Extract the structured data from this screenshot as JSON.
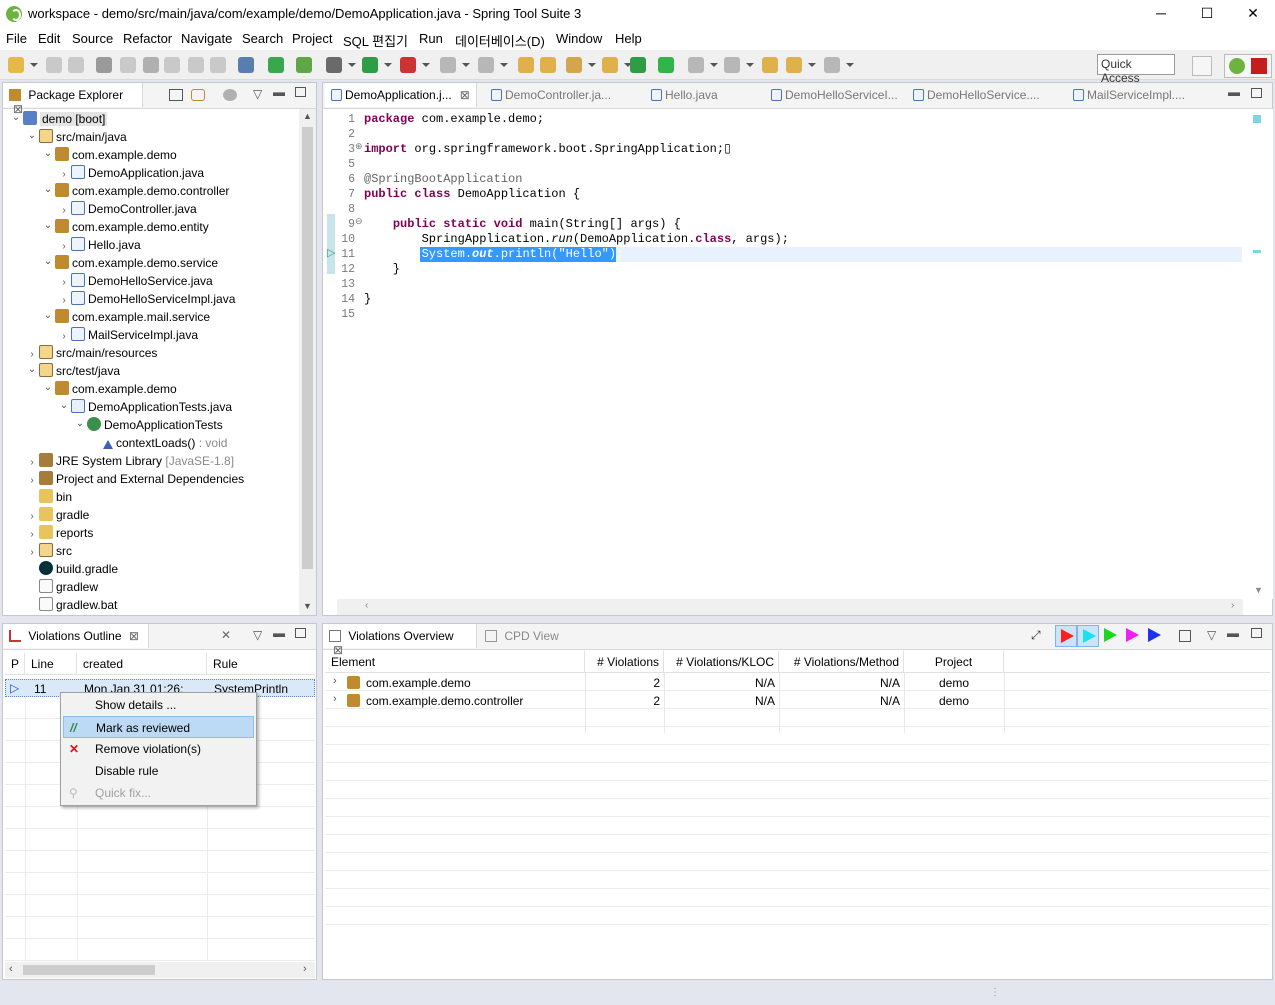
{
  "window": {
    "title": "workspace - demo/src/main/java/com/example/demo/DemoApplication.java - Spring Tool Suite 3",
    "minimize": "─",
    "maximize": "☐",
    "close": "✕"
  },
  "menu": [
    "File",
    "Edit",
    "Source",
    "Refactor",
    "Navigate",
    "Search",
    "Project",
    "SQL 편집기",
    "Run",
    "데이터베이스(D)",
    "Window",
    "Help"
  ],
  "toolbar": {
    "quick_access": "Quick Access"
  },
  "package_explorer": {
    "title": "Package Explorer",
    "close": "⊠",
    "tree": [
      {
        "label": "demo [boot]",
        "depth": 0,
        "twisty": "open",
        "icon": "project-icon"
      },
      {
        "label": "src/main/java",
        "depth": 1,
        "twisty": "open",
        "icon": "source-folder-icon"
      },
      {
        "label": "com.example.demo",
        "depth": 2,
        "twisty": "open",
        "icon": "package-icon"
      },
      {
        "label": "DemoApplication.java",
        "depth": 3,
        "twisty": "closed",
        "icon": "java-file-icon"
      },
      {
        "label": "com.example.demo.controller",
        "depth": 2,
        "twisty": "open",
        "icon": "package-icon"
      },
      {
        "label": "DemoController.java",
        "depth": 3,
        "twisty": "closed",
        "icon": "java-file-icon"
      },
      {
        "label": "com.example.demo.entity",
        "depth": 2,
        "twisty": "open",
        "icon": "package-icon"
      },
      {
        "label": "Hello.java",
        "depth": 3,
        "twisty": "closed",
        "icon": "java-file-icon"
      },
      {
        "label": "com.example.demo.service",
        "depth": 2,
        "twisty": "open",
        "icon": "package-icon"
      },
      {
        "label": "DemoHelloService.java",
        "depth": 3,
        "twisty": "closed",
        "icon": "java-file-icon"
      },
      {
        "label": "DemoHelloServiceImpl.java",
        "depth": 3,
        "twisty": "closed",
        "icon": "java-file-icon"
      },
      {
        "label": "com.example.mail.service",
        "depth": 2,
        "twisty": "open",
        "icon": "package-icon"
      },
      {
        "label": "MailServiceImpl.java",
        "depth": 3,
        "twisty": "closed",
        "icon": "java-file-icon"
      },
      {
        "label": "src/main/resources",
        "depth": 1,
        "twisty": "closed",
        "icon": "source-folder-icon"
      },
      {
        "label": "src/test/java",
        "depth": 1,
        "twisty": "open",
        "icon": "source-folder-icon"
      },
      {
        "label": "com.example.demo",
        "depth": 2,
        "twisty": "open",
        "icon": "package-icon"
      },
      {
        "label": "DemoApplicationTests.java",
        "depth": 3,
        "twisty": "open",
        "icon": "test-file-icon"
      },
      {
        "label": "DemoApplicationTests",
        "depth": 4,
        "twisty": "open",
        "icon": "class-icon"
      },
      {
        "label": "contextLoads()",
        "suffix": " : void",
        "depth": 5,
        "twisty": "none",
        "icon": "method-icon"
      },
      {
        "label": "JRE System Library",
        "suffix": " [JavaSE-1.8]",
        "depth": 1,
        "twisty": "closed",
        "icon": "library-icon"
      },
      {
        "label": "Project and External Dependencies",
        "depth": 1,
        "twisty": "closed",
        "icon": "library-icon"
      },
      {
        "label": "bin",
        "depth": 1,
        "twisty": "none",
        "icon": "folder-icon"
      },
      {
        "label": "gradle",
        "depth": 1,
        "twisty": "closed",
        "icon": "folder-icon"
      },
      {
        "label": "reports",
        "depth": 1,
        "twisty": "closed",
        "icon": "folder-icon"
      },
      {
        "label": "src",
        "depth": 1,
        "twisty": "closed",
        "icon": "source-folder-icon"
      },
      {
        "label": "build.gradle",
        "depth": 1,
        "twisty": "none",
        "icon": "gradle-icon"
      },
      {
        "label": "gradlew",
        "depth": 1,
        "twisty": "none",
        "icon": "file-icon"
      },
      {
        "label": "gradlew.bat",
        "depth": 1,
        "twisty": "none",
        "icon": "file-icon"
      }
    ]
  },
  "editor": {
    "tabs": [
      {
        "label": "DemoApplication.j...",
        "active": true
      },
      {
        "label": "DemoController.ja...",
        "active": false
      },
      {
        "label": "Hello.java",
        "active": false
      },
      {
        "label": "DemoHelloServiceI...",
        "active": false
      },
      {
        "label": "DemoHelloService....",
        "active": false
      },
      {
        "label": "MailServiceImpl....",
        "active": false
      }
    ],
    "close_tab": "⊠",
    "lines": [
      {
        "num": "1",
        "html": "<span class=\"kw\">package</span> com.example.demo;"
      },
      {
        "num": "2",
        "html": ""
      },
      {
        "num": "3",
        "html": "<span class=\"kw\">import</span> org.springframework.boot.SpringApplication;▯",
        "fold": "⊕"
      },
      {
        "num": "5",
        "html": ""
      },
      {
        "num": "6",
        "html": "<span class=\"ann\">@SpringBootApplication</span>"
      },
      {
        "num": "7",
        "html": "<span class=\"kw\">public class</span> DemoApplication {"
      },
      {
        "num": "8",
        "html": ""
      },
      {
        "num": "9",
        "html": "    <span class=\"kw\">public static void</span> main(String[] args) {",
        "fold": "⊖"
      },
      {
        "num": "10",
        "html": "        SpringApplication.<span class=\"it\">run</span>(DemoApplication.<span class=\"kw\">class</span>, args);"
      },
      {
        "num": "11",
        "html": "        System.<span class=\"it\" style=\"font-weight:bold\">out</span>.println(<span style=\"color:#fff\">\"Hello\"</span>);",
        "highlight": true
      },
      {
        "num": "12",
        "html": "    }"
      },
      {
        "num": "13",
        "html": ""
      },
      {
        "num": "14",
        "html": "}"
      },
      {
        "num": "15",
        "html": ""
      }
    ]
  },
  "violations_outline": {
    "title": "Violations Outline",
    "close": "⊠",
    "columns": [
      "P",
      "Line",
      "created",
      "Rule"
    ],
    "row": {
      "line": "11",
      "created": "Mon Jan 31 01:26:",
      "rule": "SystemPrintln"
    }
  },
  "context_menu": [
    {
      "label": "Show details ...",
      "state": "normal",
      "icon": ""
    },
    {
      "label": "Mark as reviewed",
      "state": "selected",
      "icon": "reviewed-icon"
    },
    {
      "label": "Remove violation(s)",
      "state": "normal",
      "icon": "remove-icon"
    },
    {
      "label": "Disable rule",
      "state": "normal",
      "icon": ""
    },
    {
      "label": "Quick fix...",
      "state": "disabled",
      "icon": "quickfix-icon"
    }
  ],
  "violations_overview": {
    "tab_active": "Violations Overview",
    "tab_inactive": "CPD View",
    "close": "⊠",
    "columns": [
      "Element",
      "# Violations",
      "# Violations/KLOC",
      "# Violations/Method",
      "Project"
    ],
    "rows": [
      {
        "element": "com.example.demo",
        "violations": "2",
        "kloc": "N/A",
        "method": "N/A",
        "project": "demo"
      },
      {
        "element": "com.example.demo.controller",
        "violations": "2",
        "kloc": "N/A",
        "method": "N/A",
        "project": "demo"
      }
    ],
    "priority_colors": [
      "#ff1f1f",
      "#19e2f0",
      "#19d81f",
      "#ef1fef",
      "#2030ef"
    ]
  }
}
